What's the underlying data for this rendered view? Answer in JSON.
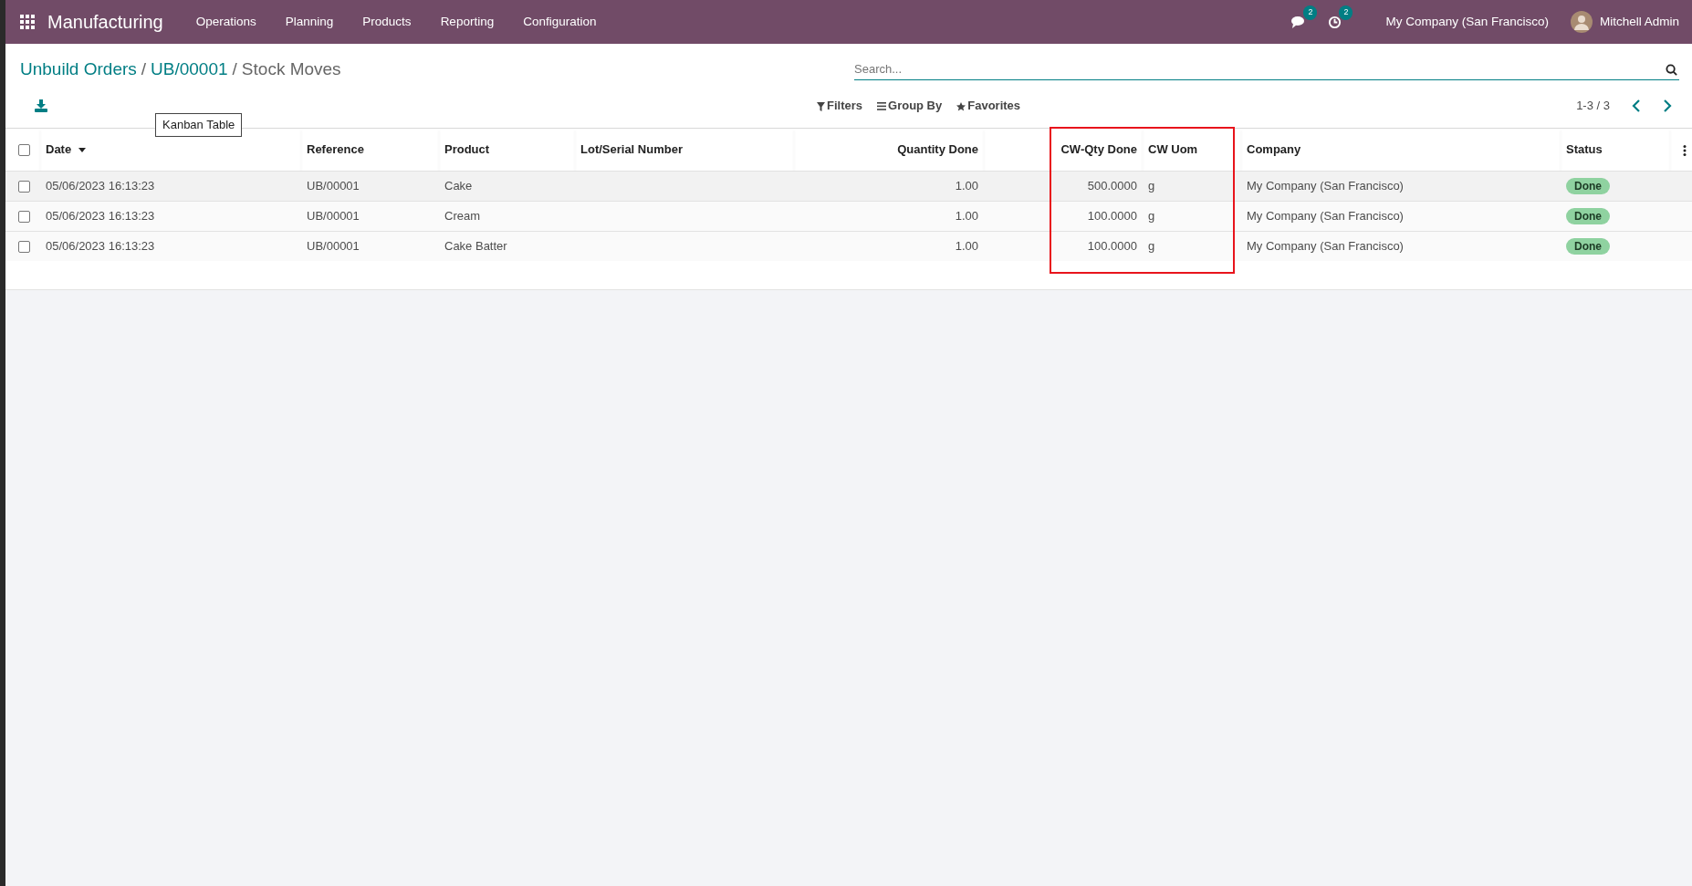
{
  "navbar": {
    "app_name": "Manufacturing",
    "menu": [
      "Operations",
      "Planning",
      "Products",
      "Reporting",
      "Configuration"
    ],
    "messages_count": "2",
    "activities_count": "2",
    "company": "My Company (San Francisco)",
    "user": "Mitchell Admin"
  },
  "breadcrumb": [
    {
      "label": "Unbuild Orders",
      "current": false
    },
    {
      "separator": "/",
      "label": "UB/00001",
      "current": false
    },
    {
      "separator": "/",
      "label": "Stock Moves",
      "current": true
    }
  ],
  "search": {
    "placeholder": "Search..."
  },
  "filters": [
    "Filters",
    "Group By",
    "Favorites"
  ],
  "pager": "1-3 / 3",
  "tooltip": "Kanban Table",
  "table": {
    "all_selected": false,
    "columns": [
      {
        "label": "Date",
        "sorted": true
      },
      {
        "label": "Reference",
        "sorted": false
      },
      {
        "label": "Product",
        "sorted": false
      },
      {
        "label": "Lot/Serial Number",
        "sorted": false
      },
      {
        "label": "Quantity Done",
        "sorted": false
      },
      {
        "label": "CW-Qty Done",
        "sorted": false
      },
      {
        "label": "CW Uom",
        "sorted": false
      },
      {
        "label": "Company",
        "sorted": false
      },
      {
        "label": "Status",
        "sorted": false
      }
    ],
    "rows": [
      {
        "date": "05/06/2023 16:13:23",
        "reference": "UB/00001",
        "product": "Cake",
        "quantity_done": "1.00",
        "cw_qty_done": "500.0000",
        "cw_uom": "g",
        "company": "My Company (San Francisco)",
        "status": "Done",
        "checked": false
      },
      {
        "date": "05/06/2023 16:13:23",
        "reference": "UB/00001",
        "product": "Cream",
        "quantity_done": "1.00",
        "cw_qty_done": "100.0000",
        "cw_uom": "g",
        "company": "My Company (San Francisco)",
        "status": "Done",
        "checked": false
      },
      {
        "date": "05/06/2023 16:13:23",
        "reference": "UB/00001",
        "product": "Cake Batter",
        "quantity_done": "1.00",
        "cw_qty_done": "100.0000",
        "cw_uom": "g",
        "company": "My Company (San Francisco)",
        "status": "Done",
        "checked": false
      }
    ]
  }
}
